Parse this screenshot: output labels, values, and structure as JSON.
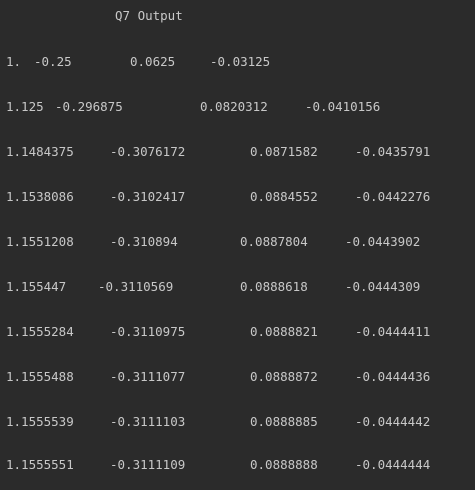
{
  "output": {
    "title": "Q7 Output",
    "rows": [
      [
        "1.",
        "-0.25",
        "0.0625",
        "-0.03125"
      ],
      [
        "1.125",
        "-0.296875",
        "0.0820312",
        "-0.0410156"
      ],
      [
        "1.1484375",
        "-0.3076172",
        "0.0871582",
        "-0.0435791"
      ],
      [
        "1.1538086",
        "-0.3102417",
        "0.0884552",
        "-0.0442276"
      ],
      [
        "1.1551208",
        "-0.310894",
        "0.0887804",
        "-0.0443902"
      ],
      [
        "1.155447",
        "-0.3110569",
        "0.0888618",
        "-0.0444309"
      ],
      [
        "1.1555284",
        "-0.3110975",
        "0.0888821",
        "-0.0444411"
      ],
      [
        "1.1555488",
        "-0.3111077",
        "0.0888872",
        "-0.0444436"
      ],
      [
        "1.1555539",
        "-0.3111103",
        "0.0888885",
        "-0.0444442"
      ],
      [
        "1.1555551",
        "-0.3111109",
        "0.0888888",
        "-0.0444444"
      ]
    ]
  }
}
